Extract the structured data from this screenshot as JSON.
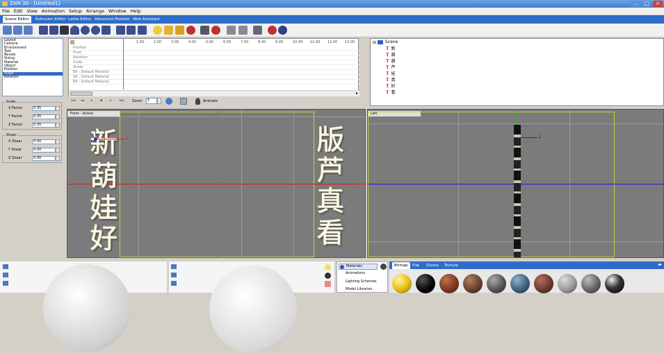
{
  "window": {
    "title": "ZAM 3D - [Untitled1]"
  },
  "menu": [
    "File",
    "Edit",
    "View",
    "Animation",
    "Setup",
    "Arrange",
    "Window",
    "Help"
  ],
  "tabs": [
    "Scene Editor",
    "Extrusion Editor",
    "Lathe Editor",
    "Advanced Modeler",
    "Web Assistant"
  ],
  "props": [
    "Layout",
    "Camera",
    "Environment",
    "Text",
    "Bevels",
    "Sizing",
    "Material",
    "Object",
    "Position",
    "Scale",
    "Rotation"
  ],
  "scale": {
    "title": "Scale",
    "x_label": "X Factor",
    "x": "0.35",
    "y_label": "Y Factor",
    "y": "0.35",
    "z_label": "Z Factor",
    "z": "0.35"
  },
  "shear": {
    "title": "Shear",
    "x_label": "X Shear",
    "x": "0.00",
    "y_label": "Y Shear",
    "y": "0.00",
    "z_label": "Z Shear",
    "z": "0.00"
  },
  "timeline": {
    "ticks": [
      "1.00",
      "2.00",
      "3.00",
      "4.00",
      "5.00",
      "6.00",
      "7.00",
      "8.00",
      "9.00",
      "10.00",
      "11.00",
      "12.00",
      "13.00"
    ],
    "rows": [
      "Position",
      "Pivot",
      "Rotation",
      "Scale",
      "Shear",
      "ER - Default Material",
      "SR - Default Material",
      "ER - Default Material"
    ],
    "zoom_label": "Zoom",
    "zoom": "5",
    "animate_label": "Animate"
  },
  "scene": {
    "root": "Scene",
    "nodes": [
      "新",
      "葫",
      "葫",
      "芦",
      "娃",
      "真",
      "好",
      "看"
    ]
  },
  "viewport_front": {
    "label": "Front - Active",
    "left_text": [
      "新",
      "葫",
      "娃",
      "好"
    ],
    "right_text": [
      "版",
      "芦",
      "真",
      "看"
    ]
  },
  "viewport_left": {
    "label": "Left"
  },
  "library": {
    "items": [
      "Materials",
      "Animations",
      "Lighting Schemes",
      "Model Libraries"
    ],
    "tabs": [
      "Bitmap",
      "Flat",
      "Glossy",
      "Texture"
    ]
  },
  "colors": {
    "accent": "#316ac5",
    "titlebar": "#3f7ed4",
    "viewport": "#7b7b7b",
    "yellow_frame": "#c8d04a",
    "red_axis": "#d02020",
    "blue_axis": "#2020d0",
    "green_axis": "#10c010"
  }
}
